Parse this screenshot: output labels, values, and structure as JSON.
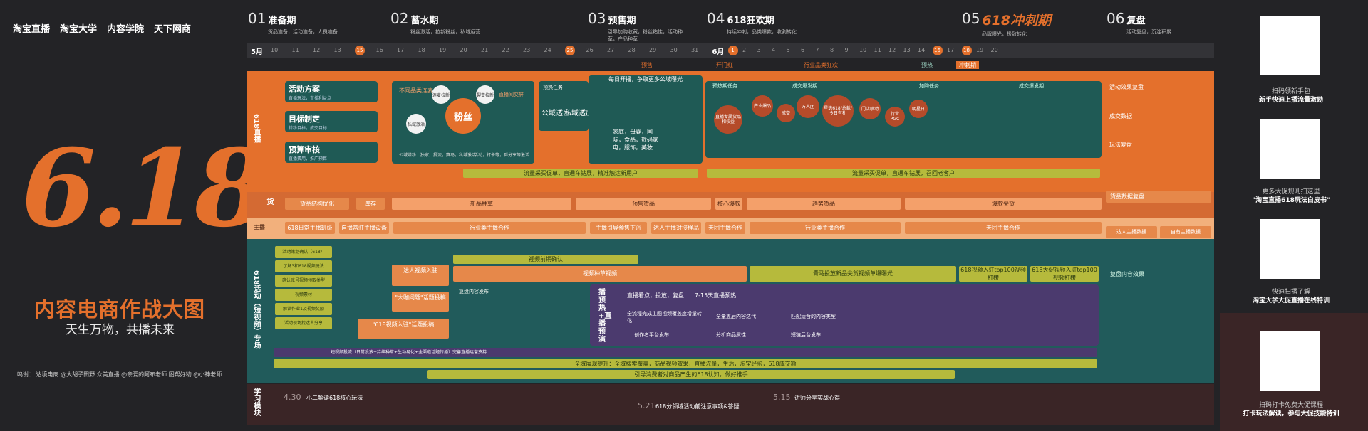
{
  "brand": {
    "items": [
      "淘宝直播",
      "淘宝大学",
      "内容学院",
      "天下网商"
    ]
  },
  "hero": {
    "big": "6.18",
    "title": "内容电商作战大图",
    "slogan": "天生万物，共播未来",
    "thanks": "鸣谢：  达境电商  @大胡子田野  众美直播  @亲爱的阿布老师  图帮好物  @小神老师"
  },
  "phases": [
    {
      "num": "01",
      "name": "准备期",
      "sub": "货品准备，活动准备，人员准备"
    },
    {
      "num": "02",
      "name": "蓄水期",
      "sub": "粉丝激活，拉新粉丝，私域运营"
    },
    {
      "num": "03",
      "name": "预售期",
      "sub": "引导加购收藏，粉丝粘性，活动种草，产品种草"
    },
    {
      "num": "04",
      "name": "618狂欢期",
      "sub": "持续冲刺，品类爆款，收割转化"
    },
    {
      "num": "05",
      "name": "618冲刺期",
      "sub": "品牌曝光，极致转化"
    },
    {
      "num": "06",
      "name": "复盘",
      "sub": "活动复盘，沉淀积累"
    }
  ],
  "timeline": {
    "may": "5月",
    "jun": "6月",
    "may_days": [
      "10",
      "11",
      "12",
      "13",
      "15",
      "16",
      "17",
      "18",
      "19",
      "20",
      "21",
      "22",
      "23",
      "24",
      "25",
      "26",
      "27",
      "28",
      "29",
      "30",
      "31"
    ],
    "jun_days": [
      "1",
      "2",
      "3",
      "4",
      "5",
      "6",
      "7",
      "8",
      "9",
      "10",
      "11",
      "12",
      "13",
      "14",
      "16",
      "17",
      "18",
      "19",
      "20"
    ],
    "hot": [
      "15",
      "25",
      "1",
      "16",
      "18"
    ],
    "segments": [
      "预售",
      "开门红",
      "行业品类狂欢",
      "预热",
      "冲刺期"
    ]
  },
  "left_boxes": {
    "a": "活动方案",
    "a_sub": "直播玩法，直播利益点",
    "b": "目标制定",
    "b_sub": "转粉目标，成交目标",
    "c": "预算审核",
    "c_sub": "直播费用，推广预算"
  },
  "row_labels": {
    "live": "618直播",
    "goods": "货",
    "anchor": "主播",
    "content": "618活动（短视频）专场",
    "learn": "学习模块"
  },
  "fans": {
    "title": "粉丝",
    "a": "不同品类连麦",
    "b": "连麦拉新",
    "c": "裂变拉新",
    "d": "直播间交屏",
    "e": "私域激活",
    "f": "公域转粉",
    "note": "公域增粉：独家，投流，赛马，私域激活",
    "ccp": "活动，打卡等，群分享等激活"
  },
  "middle": {
    "tag1": "预热任务",
    "tag2": "公域透出",
    "tag3": "私域透出",
    "tag4": "家庭，母婴，国际，食品，数码家电，服饰，美妆",
    "bottom": "流量采买促单，直通车钻展，精准触达新用户"
  },
  "right_orange": {
    "top": "每日开播，争取更多公域曝光",
    "sec1": "预热期任务",
    "sec2": "成交爆发期",
    "sec3": "加购任务",
    "sec4": "成交爆发期",
    "items": [
      "直播专属货品和权益",
      "产业爆品",
      "成交",
      "万人团",
      "星选618/总裁/今日有礼",
      "门店联动",
      "行业PGC",
      "明星日"
    ],
    "bottom": "流量采买促单，直通车钻展，召回老客户"
  },
  "goods_row": {
    "a": "货品结构优化",
    "b": "库存",
    "c": "新品种草",
    "d": "预售货品",
    "e": "核心爆款",
    "f": "趋势货品",
    "g": "爆款尖货"
  },
  "anchor_row": {
    "a": "618日常主播班级",
    "b": "自播常驻主播设备",
    "c": "行业类主播合作",
    "d": "主播引导预售下沉",
    "e": "达人主播对接样品",
    "f": "天团主播合作",
    "g": "行业类主播合作",
    "h": "天团主播合作"
  },
  "short_video": {
    "a": "活动策划确认（618）",
    "b": "了解3和618视频玩法",
    "c": "确认账号视频领取类型",
    "d": "视频素材",
    "e": "解读作业1及视频奖励",
    "f": "活动现场找达人分享",
    "g": "达人视频入驻",
    "h": "\"618视频入驻\"话题投稿",
    "i": "\"大咖问题\"话题投稿",
    "j": "复盘内容发布",
    "k": "视频前期确认",
    "l": "视频种草视频",
    "m": "青马投放新品尖货视频单爆曝光",
    "n": "618视频入驻top100视频打榜",
    "o": "618大促视频入驻top100视频打榜"
  },
  "purple": {
    "title": "播预热+直播预演",
    "a": "直播看点，投放，复盘",
    "b": "7-15天直播预热",
    "c": "全流程完成主图视频覆盖度增量转化",
    "d": "全量盖后内容迭代",
    "e": "匹配适合的内容类型",
    "f": "创作者平台发布",
    "g": "分析商品属性",
    "h": "短链后台发布"
  },
  "teal_bars": {
    "a": "短视频投流（日常投放+持续种草+生动易化+全渠道话题传播）完善直播运营支持",
    "b": "全域展现提升：全域搜索覆盖，商品视频效果，直播流量，生活，淘宝经验，618成交额",
    "c": "引导消费者对商品产生的618认知，做好推手"
  },
  "right_col": {
    "a": "活动效果复盘",
    "b": "成交数据",
    "c": "玩法复盘",
    "d": "货品数据复盘",
    "e": "达人主播数据",
    "f": "自有主播数据",
    "g": "复盘内容效果"
  },
  "learn": [
    {
      "d": "4.30",
      "t": "小二解读618核心玩法"
    },
    {
      "d": "5.21",
      "t": "618分领域活动前注意事项&答疑"
    },
    {
      "d": "5.15",
      "t": "讲师分享实战心得"
    }
  ],
  "qr": [
    {
      "label": "扫码领新手包",
      "title": "新手快速上播流量激励"
    },
    {
      "label": "更多大促规则扫这里",
      "title": "\"淘宝直播618玩法白皮书\""
    },
    {
      "label": "快速扫播了解",
      "title": "淘宝大学大促直播在线特训"
    },
    {
      "label": "扫码打卡免费大促课程",
      "title": "打卡玩法解读，参与大促技能特训"
    }
  ]
}
